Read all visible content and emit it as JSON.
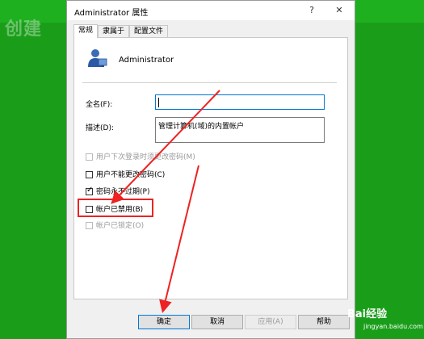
{
  "dialog": {
    "title": "Administrator 属性",
    "help_button": "?",
    "close_button": "✕"
  },
  "tabs": [
    {
      "label": "常规"
    },
    {
      "label": "隶属于"
    },
    {
      "label": "配置文件"
    }
  ],
  "user": {
    "name": "Administrator"
  },
  "fields": {
    "fullname": {
      "label": "全名(F):",
      "value": ""
    },
    "description": {
      "label": "描述(D):",
      "value": "管理计算机(域)的内置帐户"
    }
  },
  "checkboxes": [
    {
      "label": "用户下次登录时须更改密码(M)",
      "checked": false,
      "disabled": true
    },
    {
      "label": "用户不能更改密码(C)",
      "checked": false,
      "disabled": false
    },
    {
      "label": "密码永不过期(P)",
      "checked": true,
      "disabled": false
    },
    {
      "label": "帐户已禁用(B)",
      "checked": false,
      "disabled": false
    },
    {
      "label": "帐户已锁定(O)",
      "checked": false,
      "disabled": true
    }
  ],
  "buttons": {
    "ok": "确定",
    "cancel": "取消",
    "apply": "应用(A)",
    "help": "帮助"
  },
  "overlay": {
    "bg_text": "创建",
    "watermark": "Bai经验",
    "watermark_url": "jingyan.baidu.com"
  },
  "colors": {
    "accent": "#0078d7",
    "annotation": "#ee2222",
    "background": "#1a9e1a"
  }
}
